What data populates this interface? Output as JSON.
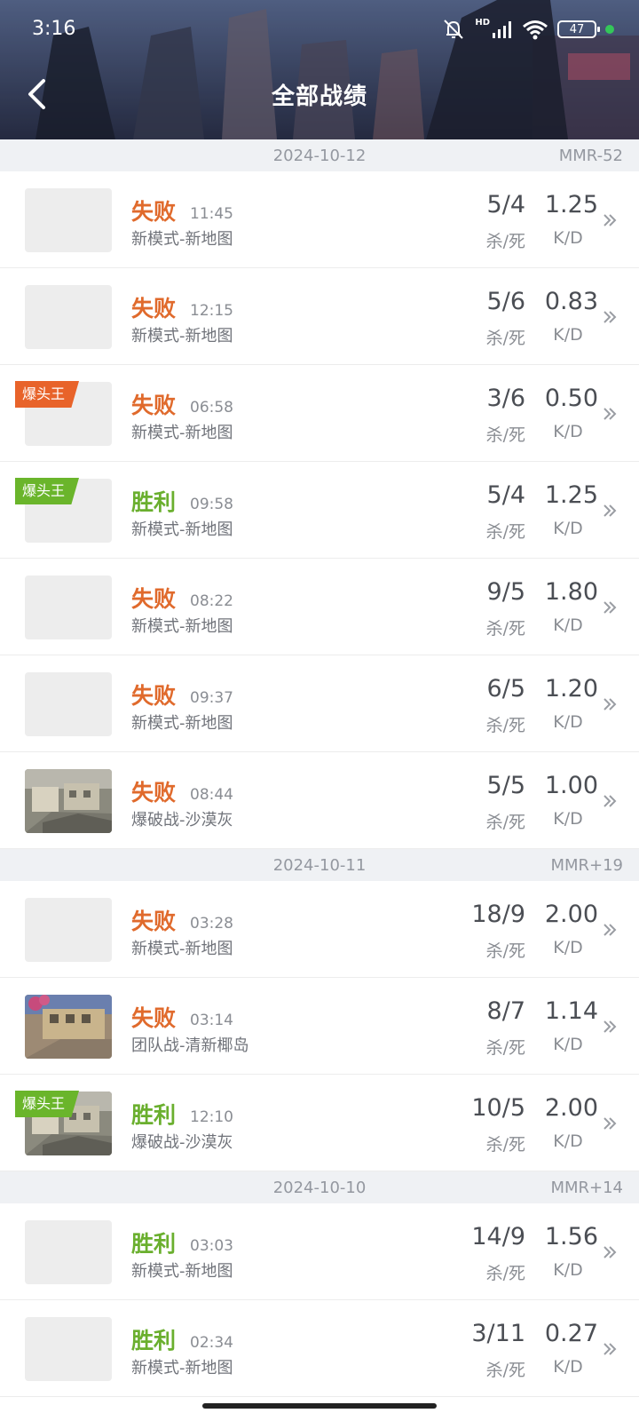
{
  "status_bar": {
    "time": "3:16",
    "battery": "47",
    "net": "HD"
  },
  "header": {
    "title": "全部战绩"
  },
  "colors": {
    "lose": "#e06a2c",
    "win": "#6aaf2e",
    "badge_lose": "#e8632a",
    "badge_win": "#6ab52b"
  },
  "labels": {
    "kills_deaths": "杀/死",
    "kd": "K/D"
  },
  "groups": [
    {
      "date": "2024-10-12",
      "mmr": "MMR-52",
      "matches": [
        {
          "result": "失败",
          "outcome": "lose",
          "time": "11:45",
          "mode": "新模式-新地图",
          "kills": "5/4",
          "ratio": "1.25",
          "badge": "",
          "thumb": "blank"
        },
        {
          "result": "失败",
          "outcome": "lose",
          "time": "12:15",
          "mode": "新模式-新地图",
          "kills": "5/6",
          "ratio": "0.83",
          "badge": "",
          "thumb": "blank"
        },
        {
          "result": "失败",
          "outcome": "lose",
          "time": "06:58",
          "mode": "新模式-新地图",
          "kills": "3/6",
          "ratio": "0.50",
          "badge": "爆头王",
          "thumb": "blank"
        },
        {
          "result": "胜利",
          "outcome": "win",
          "time": "09:58",
          "mode": "新模式-新地图",
          "kills": "5/4",
          "ratio": "1.25",
          "badge": "爆头王",
          "thumb": "blank"
        },
        {
          "result": "失败",
          "outcome": "lose",
          "time": "08:22",
          "mode": "新模式-新地图",
          "kills": "9/5",
          "ratio": "1.80",
          "badge": "",
          "thumb": "blank"
        },
        {
          "result": "失败",
          "outcome": "lose",
          "time": "09:37",
          "mode": "新模式-新地图",
          "kills": "6/5",
          "ratio": "1.20",
          "badge": "",
          "thumb": "blank"
        },
        {
          "result": "失败",
          "outcome": "lose",
          "time": "08:44",
          "mode": "爆破战-沙漠灰",
          "kills": "5/5",
          "ratio": "1.00",
          "badge": "",
          "thumb": "desert"
        }
      ]
    },
    {
      "date": "2024-10-11",
      "mmr": "MMR+19",
      "matches": [
        {
          "result": "失败",
          "outcome": "lose",
          "time": "03:28",
          "mode": "新模式-新地图",
          "kills": "18/9",
          "ratio": "2.00",
          "badge": "",
          "thumb": "blank"
        },
        {
          "result": "失败",
          "outcome": "lose",
          "time": "03:14",
          "mode": "团队战-清新椰岛",
          "kills": "8/7",
          "ratio": "1.14",
          "badge": "",
          "thumb": "island"
        },
        {
          "result": "胜利",
          "outcome": "win",
          "time": "12:10",
          "mode": "爆破战-沙漠灰",
          "kills": "10/5",
          "ratio": "2.00",
          "badge": "爆头王",
          "thumb": "desert"
        }
      ]
    },
    {
      "date": "2024-10-10",
      "mmr": "MMR+14",
      "matches": [
        {
          "result": "胜利",
          "outcome": "win",
          "time": "03:03",
          "mode": "新模式-新地图",
          "kills": "14/9",
          "ratio": "1.56",
          "badge": "",
          "thumb": "blank"
        },
        {
          "result": "胜利",
          "outcome": "win",
          "time": "02:34",
          "mode": "新模式-新地图",
          "kills": "3/11",
          "ratio": "0.27",
          "badge": "",
          "thumb": "blank"
        }
      ]
    }
  ]
}
